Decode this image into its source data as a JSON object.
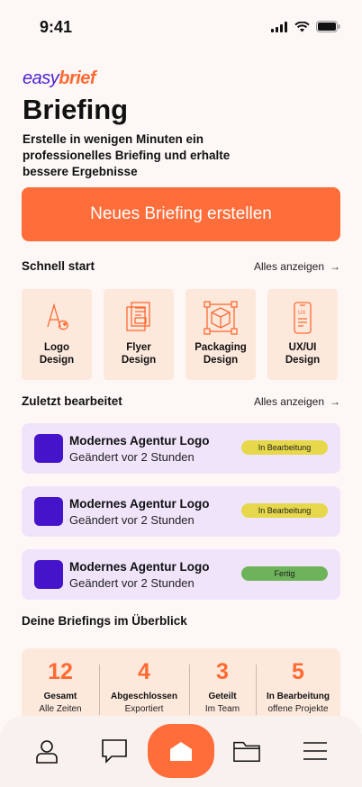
{
  "status_bar": {
    "time": "9:41"
  },
  "brand": {
    "part1": "easy",
    "part2": "brief"
  },
  "header": {
    "title": "Briefing",
    "subtitle": "Erstelle in wenigen Minuten ein professionelles Briefing und erhalte bessere Ergebnisse"
  },
  "cta": {
    "label": "Neues Briefing erstellen"
  },
  "quick_start": {
    "title": "Schnell start",
    "see_all": "Alles anzeigen",
    "items": [
      {
        "label": "Logo\nDesign",
        "icon": "logo-design-icon"
      },
      {
        "label": "Flyer\nDesign",
        "icon": "flyer-design-icon"
      },
      {
        "label": "Packaging\nDesign",
        "icon": "packaging-design-icon"
      },
      {
        "label": "UX/UI\nDesign",
        "icon": "ux-ui-design-icon"
      }
    ]
  },
  "recent": {
    "title": "Zuletzt bearbeitet",
    "see_all": "Alles anzeigen",
    "items": [
      {
        "title": "Modernes Agentur Logo",
        "meta": "Geändert vor 2 Stunden",
        "status": "In Bearbeitung",
        "status_color": "#e6d84a"
      },
      {
        "title": "Modernes Agentur Logo",
        "meta": "Geändert vor 2 Stunden",
        "status": "In Bearbeitung",
        "status_color": "#e6d84a"
      },
      {
        "title": "Modernes Agentur Logo",
        "meta": "Geändert vor 2 Stunden",
        "status": "Fertig",
        "status_color": "#6db35a"
      }
    ]
  },
  "overview": {
    "title": "Deine Briefings im Überblick",
    "stats": [
      {
        "value": "12",
        "label": "Gesamt",
        "sub": "Alle Zeiten"
      },
      {
        "value": "4",
        "label": "Abgeschlossen",
        "sub": "Exportiert"
      },
      {
        "value": "3",
        "label": "Geteilt",
        "sub": "Im Team"
      },
      {
        "value": "5",
        "label": "In Bearbeitung",
        "sub": "offene Projekte"
      }
    ]
  },
  "colors": {
    "accent": "#ff6d3a",
    "brand_purple": "#4b1fcf",
    "card_peach": "#fde8dc",
    "card_lavender": "#f0e4fb"
  },
  "nav": [
    "profile-icon",
    "chat-icon",
    "home-icon",
    "folder-icon",
    "menu-icon"
  ]
}
